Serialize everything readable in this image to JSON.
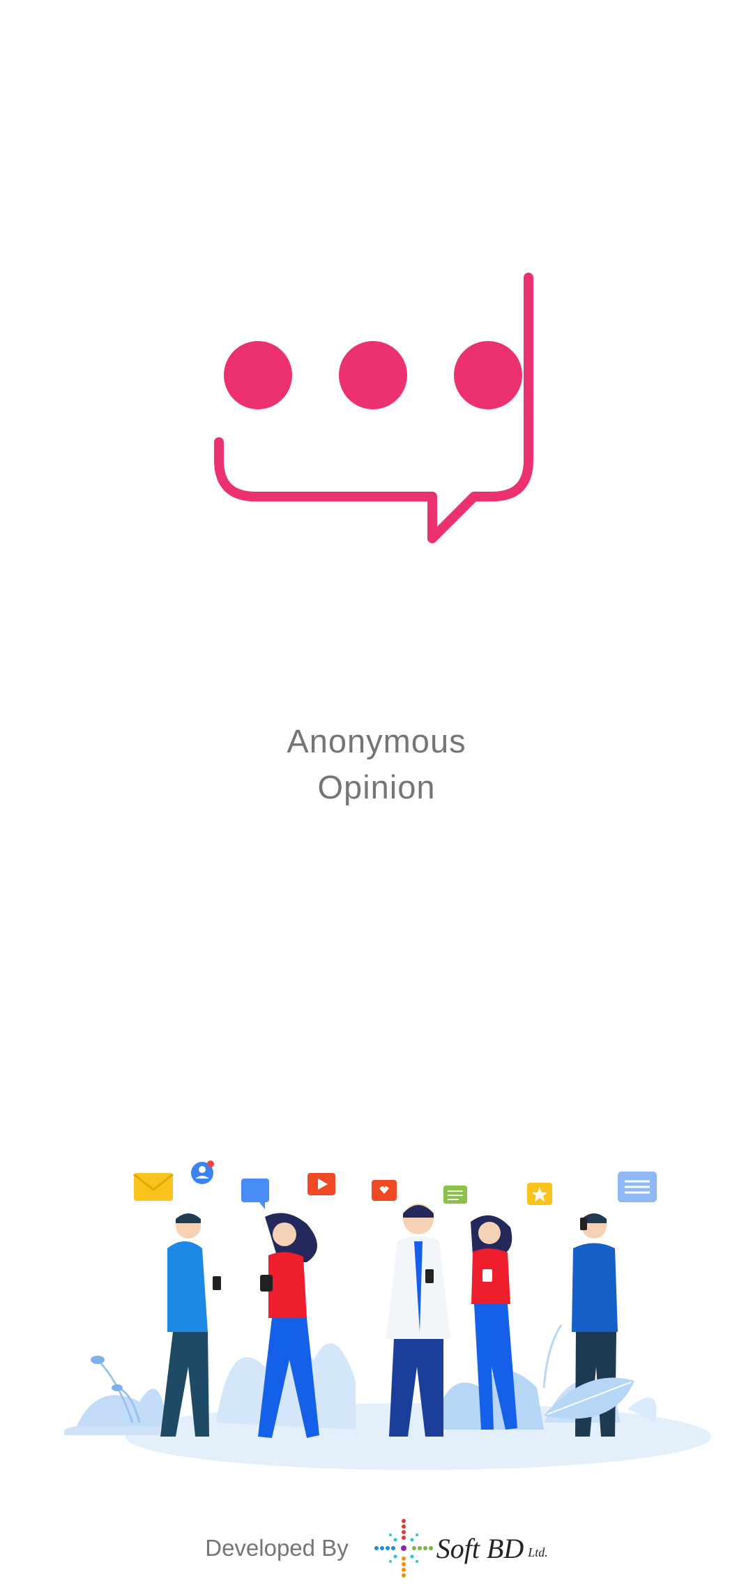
{
  "app": {
    "name_line1": "Anonymous",
    "name_line2": "Opinion",
    "logo_icon": "chat-bubble-dots-icon",
    "accent_color": "#EC316F"
  },
  "footer": {
    "developed_by": "Developed By",
    "company_name": "Soft BD",
    "company_suffix": "Ltd."
  }
}
